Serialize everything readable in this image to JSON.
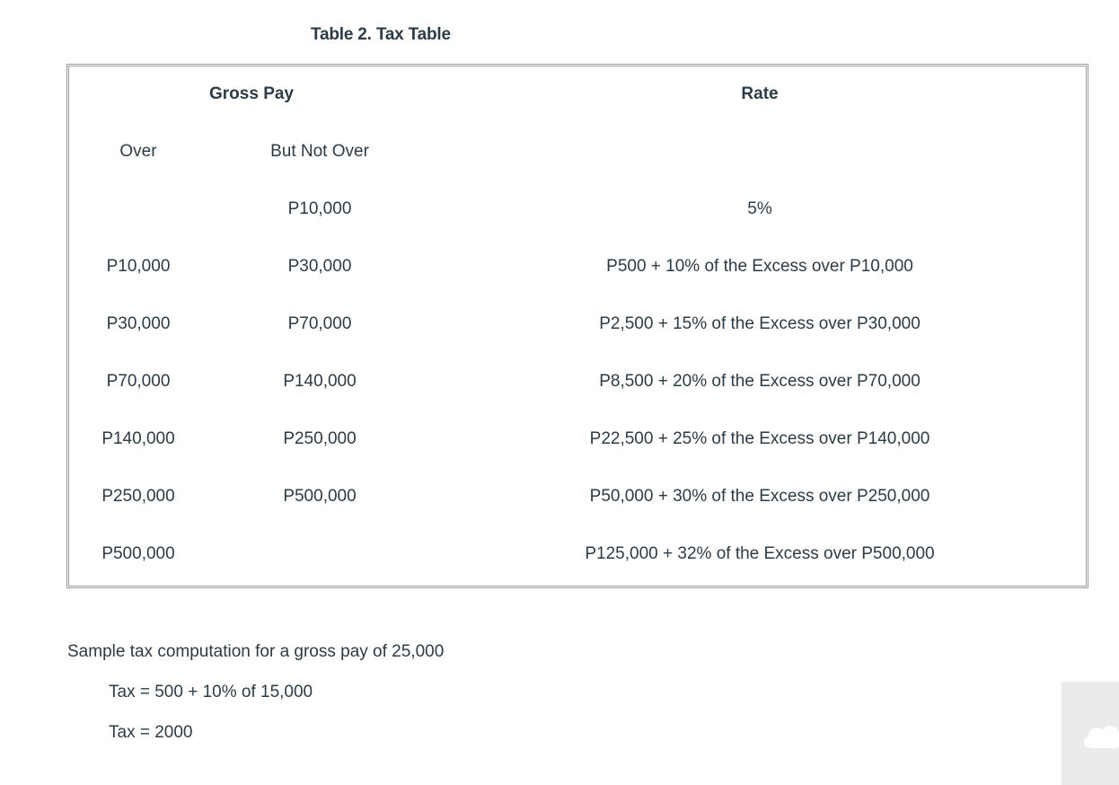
{
  "caption": "Table 2. Tax Table",
  "table": {
    "header_gross": "Gross Pay",
    "header_rate": "Rate",
    "sub_over": "Over",
    "sub_not_over": "But Not Over",
    "rows": [
      {
        "over": "",
        "not_over": "P10,000",
        "rate": "5%"
      },
      {
        "over": "P10,000",
        "not_over": "P30,000",
        "rate": "P500 + 10% of the Excess over P10,000"
      },
      {
        "over": "P30,000",
        "not_over": "P70,000",
        "rate": "P2,500 + 15% of the Excess over P30,000"
      },
      {
        "over": "P70,000",
        "not_over": "P140,000",
        "rate": "P8,500 + 20% of the Excess over P70,000"
      },
      {
        "over": "P140,000",
        "not_over": "P250,000",
        "rate": "P22,500 + 25% of the Excess over P140,000"
      },
      {
        "over": "P250,000",
        "not_over": "P500,000",
        "rate": "P50,000 + 30% of the Excess over P250,000"
      },
      {
        "over": "P500,000",
        "not_over": "",
        "rate": "P125,000 + 32% of the Excess over P500,000"
      }
    ]
  },
  "sample": {
    "title": "Sample tax computation for a gross pay of 25,000",
    "line1": "Tax = 500 + 10% of 15,000",
    "line2": "Tax = 2000"
  },
  "corner_widget_icon": "cloud-icon"
}
